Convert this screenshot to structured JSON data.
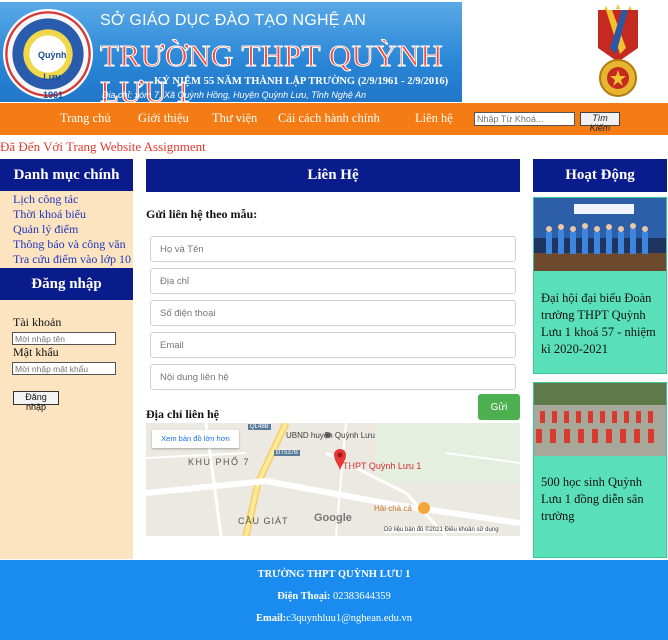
{
  "header": {
    "department": "SỞ GIÁO DỤC ĐÀO TẠO NGHỆ AN",
    "school_title": "TRƯỜNG THPT QUỲNH LƯU 1",
    "anniversary": "KỶ NIỆM 55 NĂM THÀNH LẬP TRƯỜNG (2/9/1961 - 2/9/2016)",
    "address": "Địa chỉ: xóm 7, Xã Quỳnh Hồng,  Huyện Quỳnh Lưu, Tỉnh Nghệ An",
    "logo_text": "Quỳnh Lưu",
    "logo_year": "1961"
  },
  "nav": {
    "items": [
      "Trang chủ",
      "Giới thiệu",
      "Thư viện",
      "Cải cách hành chính",
      "Liên hệ"
    ],
    "search_placeholder": "Nhập Từ Khoá...",
    "search_button": "Tìm Kiếm"
  },
  "welcome": "Đã Đến Với Trang Website Assignment",
  "left": {
    "menu_title": "Danh mục chính",
    "menu_items": [
      "Lịch công tác",
      "Thời khoá biểu",
      "Quản lý điểm",
      "Thông báo và công văn",
      "Tra cứu điểm vào lớp 10"
    ],
    "login_title": "Đăng nhập",
    "username_label": "Tài khoản",
    "username_placeholder": "Mời nhập tên",
    "password_label": "Mật khẩu",
    "password_placeholder": "Mời nhập mật khẩu",
    "login_button": "Đăng nhập"
  },
  "contact": {
    "title": "Liên Hệ",
    "form_title": "Gửi liên hệ theo mẫu:",
    "fields": {
      "name": "Họ và Tên",
      "address": "Địa chỉ",
      "phone": "Số điện thoại",
      "email": "Email",
      "content": "Nội dung liên hệ"
    },
    "send_button": "Gửi",
    "address_title": "Địa chỉ liên hệ",
    "map": {
      "view_larger": "Xem bản đồ lớn hơn",
      "place_label": "THPT Quỳnh Lưu 1",
      "ubnd": "UBND huyện Quỳnh Lưu",
      "khu_pho": "KHU PHỐ 7",
      "cau_giat": "CẦU GIÁT",
      "hai_cha_ca": "Hải chả cá",
      "road_1": "QL48B",
      "road_2": "ĐT537B",
      "google": "Google",
      "attribution": "Dữ liệu bản đồ ©2021   Điều khoản sử dụng"
    }
  },
  "activities": {
    "title": "Hoạt Động",
    "items": [
      {
        "text": "Đại hội đại biểu Đoàn trường THPT Quỳnh Lưu 1 khoá 57 - nhiệm kì 2020-2021"
      },
      {
        "text": "500 học sinh Quỳnh Lưu 1 đồng diễn sân trường"
      }
    ]
  },
  "footer": {
    "school": "TRƯỜNG THPT QUỲNH LƯU 1",
    "phone_label": "Điện Thoại:",
    "phone": " 02383644359",
    "email_label": "Email:",
    "email": "c3quynhluu1@nghean.edu.vn"
  },
  "colors": {
    "nav_bg": "#f57c14",
    "heading_bg": "#0a1b8c",
    "sidebar_bg": "#fce4c0",
    "activity_bg": "#5ae0b8",
    "footer_bg": "#1a8cf0",
    "send_button": "#4caf50",
    "welcome_text": "#e03a2e"
  }
}
